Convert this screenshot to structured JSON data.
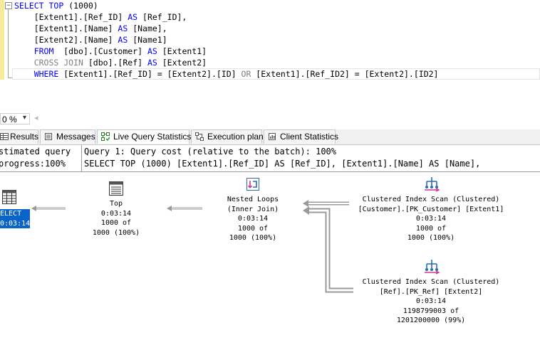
{
  "editor": {
    "lines": [
      [
        {
          "t": "SELECT",
          "c": "kw"
        },
        {
          "t": " ",
          "c": ""
        },
        {
          "t": "TOP",
          "c": "kw"
        },
        {
          "t": " (1000)",
          "c": ""
        }
      ],
      [
        {
          "t": "    [Extent1].[Ref_ID] ",
          "c": ""
        },
        {
          "t": "AS",
          "c": "kw"
        },
        {
          "t": " [Ref_ID],",
          "c": ""
        }
      ],
      [
        {
          "t": "    [Extent1].[Name] ",
          "c": ""
        },
        {
          "t": "AS",
          "c": "kw"
        },
        {
          "t": " [Name],",
          "c": ""
        }
      ],
      [
        {
          "t": "    [Extent2].[Name] ",
          "c": ""
        },
        {
          "t": "AS",
          "c": "kw"
        },
        {
          "t": " [Name1]",
          "c": ""
        }
      ],
      [
        {
          "t": "    ",
          "c": ""
        },
        {
          "t": "FROM",
          "c": "kw"
        },
        {
          "t": "  [dbo].[Customer] ",
          "c": ""
        },
        {
          "t": "AS",
          "c": "kw"
        },
        {
          "t": " [Extent1]",
          "c": ""
        }
      ],
      [
        {
          "t": "    ",
          "c": ""
        },
        {
          "t": "CROSS JOIN",
          "c": "gr"
        },
        {
          "t": " [dbo].[Ref] ",
          "c": ""
        },
        {
          "t": "AS",
          "c": "kw"
        },
        {
          "t": " [Extent2]",
          "c": ""
        }
      ],
      [
        {
          "t": "    ",
          "c": ""
        },
        {
          "t": "WHERE",
          "c": "kw"
        },
        {
          "t": " [Extent1].[Ref_ID] = [Extent2].[ID] ",
          "c": ""
        },
        {
          "t": "OR",
          "c": "gr"
        },
        {
          "t": " [Extent1].[Ref_ID2] = [Extent2].[ID2]",
          "c": ""
        }
      ]
    ]
  },
  "zoom": {
    "value": "0 %",
    "arrow": "▾",
    "scroll": "◂"
  },
  "tabs": [
    {
      "label": "Results",
      "icon": "grid-icon"
    },
    {
      "label": "Messages",
      "icon": "messages-icon"
    },
    {
      "label": "Live Query Statistics",
      "icon": "live-stats-icon",
      "active": true
    },
    {
      "label": "Execution plan",
      "icon": "execution-plan-icon"
    },
    {
      "label": "Client Statistics",
      "icon": "client-stats-icon"
    }
  ],
  "messages": {
    "left_line1": "stimated query",
    "left_line2": "progress:100%",
    "right_line1": "Query 1: Query cost (relative to the batch): 100%",
    "right_line2": "SELECT TOP (1000) [Extent1].[Ref_ID] AS [Ref_ID], [Extent1].[Name] AS [Name],"
  },
  "plan": {
    "select": {
      "line1": "ELECT",
      "line2": "0:03:14"
    },
    "top": {
      "line1": "Top",
      "line2": "0:03:14",
      "line3": "1000 of",
      "line4": "1000 (100%)"
    },
    "nested": {
      "line1": "Nested Loops",
      "line2": "(Inner Join)",
      "line3": "0:03:14",
      "line4": "1000 of",
      "line5": "1000 (100%)"
    },
    "scan1": {
      "line1": "Clustered Index Scan (Clustered)",
      "line2": "[Customer].[PK_Customer] [Extent1]",
      "line3": "0:03:14",
      "line4": "1000 of",
      "line5": "1000 (100%)"
    },
    "scan2": {
      "line1": "Clustered Index Scan (Clustered)",
      "line2": "[Ref].[PK_Ref] [Extent2]",
      "line3": "0:03:14",
      "line4": "1198799003 of",
      "line5": "1201200000 (99%)"
    }
  },
  "colors": {
    "keyword": "#0000ff",
    "comment_gray": "#808080",
    "selection": "#0a64c8",
    "gutter": "#f4ec98"
  }
}
